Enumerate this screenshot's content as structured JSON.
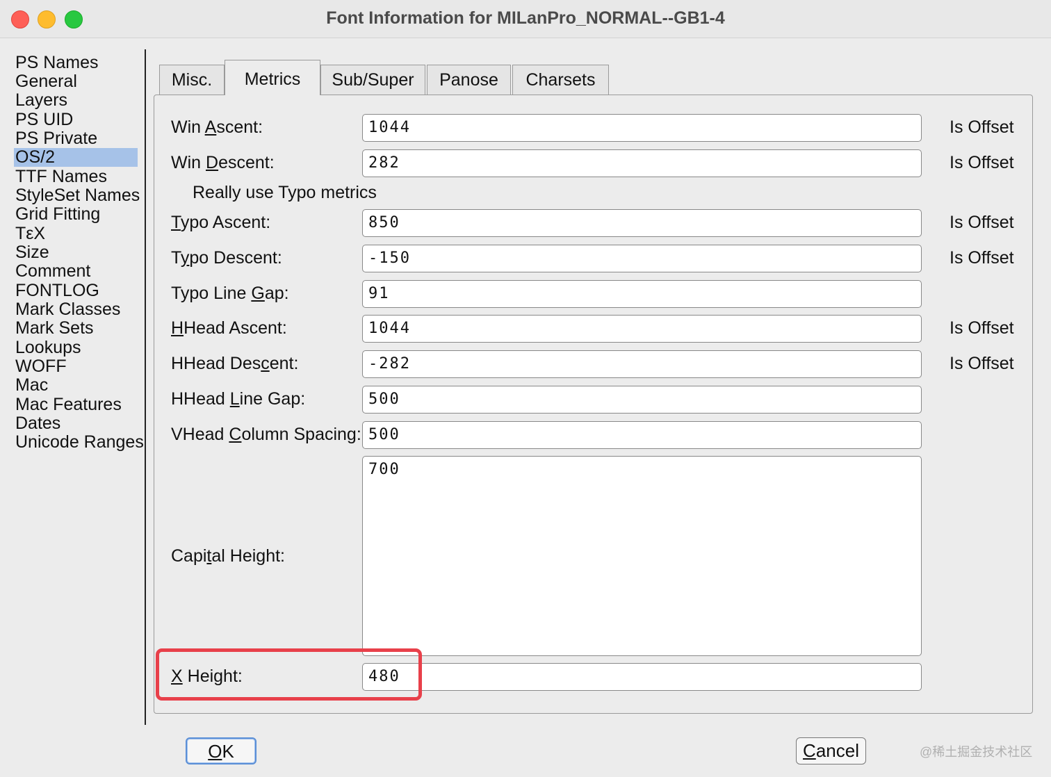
{
  "window": {
    "title": "Font Information for MILanPro_NORMAL--GB1-4"
  },
  "sidebar": {
    "items": [
      {
        "label": "PS Names"
      },
      {
        "label": "General"
      },
      {
        "label": "Layers"
      },
      {
        "label": "PS UID"
      },
      {
        "label": "PS Private"
      },
      {
        "label": "OS/2"
      },
      {
        "label": "TTF Names"
      },
      {
        "label": "StyleSet Names"
      },
      {
        "label": "Grid Fitting"
      },
      {
        "label": "TεX"
      },
      {
        "label": "Size"
      },
      {
        "label": "Comment"
      },
      {
        "label": "FONTLOG"
      },
      {
        "label": "Mark Classes"
      },
      {
        "label": "Mark Sets"
      },
      {
        "label": "Lookups"
      },
      {
        "label": "WOFF"
      },
      {
        "label": "Mac"
      },
      {
        "label": "Mac Features"
      },
      {
        "label": "Dates"
      },
      {
        "label": "Unicode Ranges"
      }
    ],
    "selected": "OS/2"
  },
  "tabs": [
    {
      "label": "Misc."
    },
    {
      "label": "Metrics"
    },
    {
      "label": "Sub/Super"
    },
    {
      "label": "Panose"
    },
    {
      "label": "Charsets"
    }
  ],
  "active_tab": "Metrics",
  "metrics": {
    "win_ascent": {
      "label_pre": "Win ",
      "label_ul": "A",
      "label_post": "scent:",
      "value": "1044",
      "offset_label": "Is Offset"
    },
    "win_descent": {
      "label_pre": "Win ",
      "label_ul": "D",
      "label_post": "escent:",
      "value": "282",
      "offset_label": "Is Offset"
    },
    "really_use_typo": {
      "label": "Really use Typo metrics"
    },
    "typo_ascent": {
      "label_pre": "",
      "label_ul": "T",
      "label_post": "ypo Ascent:",
      "value": "850",
      "offset_label": "Is Offset"
    },
    "typo_descent": {
      "label_pre": "T",
      "label_ul": "y",
      "label_post": "po Descent:",
      "value": "-150",
      "offset_label": "Is Offset"
    },
    "typo_line_gap": {
      "label_pre": "Typo Line ",
      "label_ul": "G",
      "label_post": "ap:",
      "value": "91"
    },
    "hhead_ascent": {
      "label_pre": "",
      "label_ul": "H",
      "label_post": "Head Ascent:",
      "value": "1044",
      "offset_label": "Is Offset"
    },
    "hhead_descent": {
      "label_pre": "HHead Des",
      "label_ul": "c",
      "label_post": "ent:",
      "value": "-282",
      "offset_label": "Is Offset"
    },
    "hhead_line_gap": {
      "label_pre": "HHead ",
      "label_ul": "L",
      "label_post": "ine Gap:",
      "value": "500"
    },
    "vhead_column_spacing": {
      "label_pre": "VHead ",
      "label_ul": "C",
      "label_post": "olumn Spacing:",
      "value": "500"
    },
    "capital_height": {
      "label_pre": "Capi",
      "label_ul": "t",
      "label_post": "al Height:",
      "value": "700"
    },
    "x_height": {
      "label_pre": "",
      "label_ul": "X",
      "label_post": " Height:",
      "value": "480"
    }
  },
  "buttons": {
    "ok_pre": "",
    "ok_ul": "O",
    "ok_post": "K",
    "cancel_pre": "",
    "cancel_ul": "C",
    "cancel_post": "ancel"
  },
  "watermark": "@稀土掘金技术社区",
  "colors": {
    "selection": "#a6c2e8",
    "highlight_box": "#e8404a",
    "ok_border": "#5b8fd6"
  }
}
